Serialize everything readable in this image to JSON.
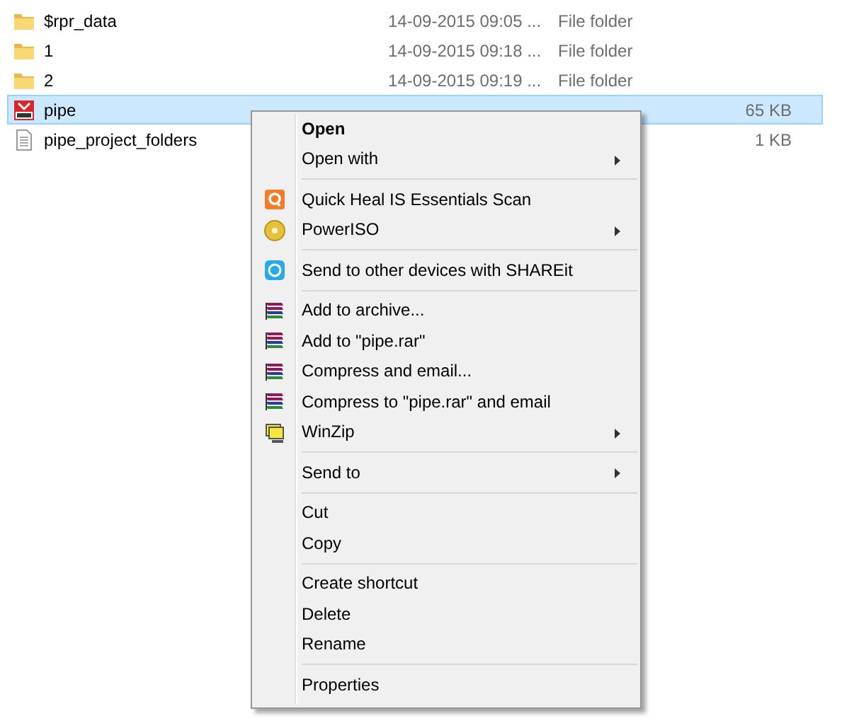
{
  "files": [
    {
      "name": "$rpr_data",
      "date": "14-09-2015 09:05 ...",
      "type": "File folder",
      "kind": "folder",
      "selected": false
    },
    {
      "name": "1",
      "date": "14-09-2015 09:18 ...",
      "type": "File folder",
      "kind": "folder",
      "selected": false
    },
    {
      "name": "2",
      "date": "14-09-2015 09:19 ...",
      "type": "File folder",
      "kind": "folder",
      "selected": false
    },
    {
      "name": "pipe",
      "size": "65 KB",
      "kind": "part",
      "selected": true
    },
    {
      "name": "pipe_project_folders",
      "size": "1 KB",
      "kind": "document",
      "selected": false
    }
  ],
  "context_menu": [
    {
      "kind": "item",
      "label": "Open",
      "bold": true
    },
    {
      "kind": "item",
      "label": "Open with",
      "submenu": true
    },
    {
      "kind": "separator"
    },
    {
      "kind": "scan",
      "label": "Quick Heal IS Essentials Scan"
    },
    {
      "kind": "disc",
      "label": "PowerISO",
      "submenu": true
    },
    {
      "kind": "separator"
    },
    {
      "kind": "share",
      "label": "Send to other devices with SHAREit"
    },
    {
      "kind": "separator"
    },
    {
      "kind": "archive",
      "label": "Add to archive..."
    },
    {
      "kind": "archive",
      "label": "Add to \"pipe.rar\""
    },
    {
      "kind": "archive",
      "label": "Compress and email..."
    },
    {
      "kind": "archive",
      "label": "Compress to \"pipe.rar\" and email"
    },
    {
      "kind": "zip",
      "label": "WinZip",
      "submenu": true
    },
    {
      "kind": "separator"
    },
    {
      "kind": "item",
      "label": "Send to",
      "submenu": true
    },
    {
      "kind": "separator"
    },
    {
      "kind": "item",
      "label": "Cut"
    },
    {
      "kind": "item",
      "label": "Copy"
    },
    {
      "kind": "separator"
    },
    {
      "kind": "item",
      "label": "Create shortcut"
    },
    {
      "kind": "item",
      "label": "Delete"
    },
    {
      "kind": "item",
      "label": "Rename"
    },
    {
      "kind": "separator"
    },
    {
      "kind": "item",
      "label": "Properties"
    }
  ]
}
